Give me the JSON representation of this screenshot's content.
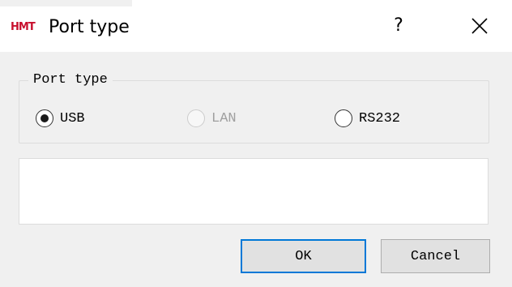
{
  "window": {
    "logo_text": "HMT",
    "title": "Port type",
    "help_label": "?",
    "close_icon": "close-x-icon"
  },
  "port_type_group": {
    "legend": "Port type",
    "options": [
      {
        "label": "USB",
        "checked": true,
        "enabled": true
      },
      {
        "label": "LAN",
        "checked": false,
        "enabled": false
      },
      {
        "label": "RS232",
        "checked": false,
        "enabled": true
      }
    ]
  },
  "info_box": {
    "value": ""
  },
  "buttons": {
    "ok_label": "OK",
    "cancel_label": "Cancel"
  },
  "colors": {
    "logo": "#c8102e",
    "focus_border": "#0078d7",
    "dialog_bg": "#f0f0f0"
  }
}
